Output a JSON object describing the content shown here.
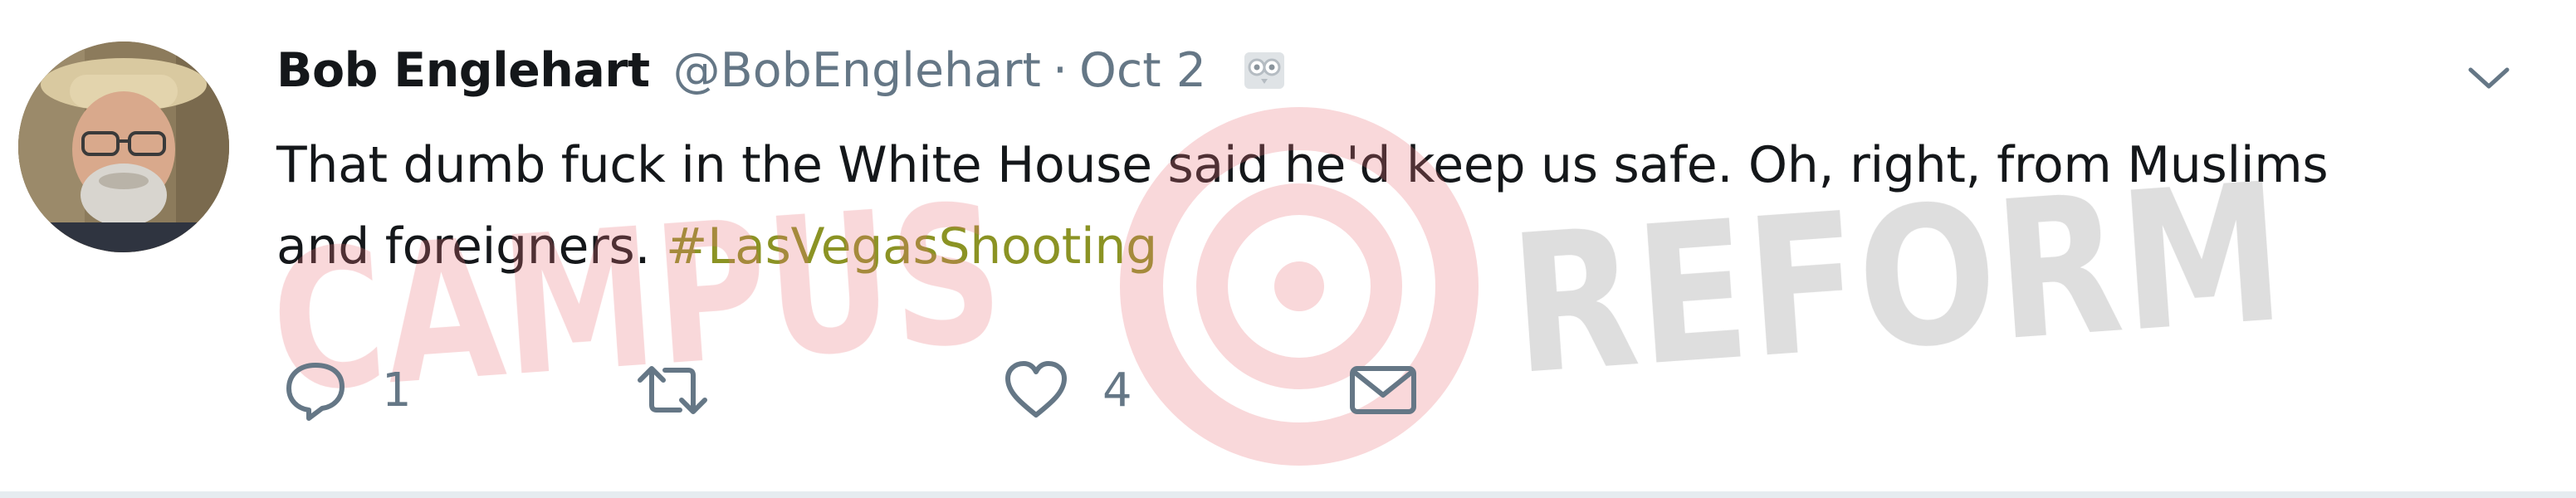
{
  "tweet": {
    "fullname": "Bob Englehart",
    "username": "@BobEnglehart",
    "separator": "·",
    "timestamp": "Oct 2",
    "text": "That dumb fuck in the White House said he'd keep us safe. Oh, right, from Muslims and foreigners.",
    "hashtag": "#LasVegasShooting"
  },
  "actions": {
    "reply_count": "1",
    "retweet_count": "",
    "like_count": "4"
  },
  "icons": {
    "avatar": "profile-photo",
    "owl": "owl-icon",
    "caret": "chevron-down-icon",
    "reply": "reply-icon",
    "retweet": "retweet-icon",
    "like": "heart-icon",
    "dm": "envelope-icon"
  },
  "watermark": {
    "left_text": "CAMPUS",
    "right_text": "REFORM",
    "left_color": "#e8747a",
    "right_color": "#8a8a8a"
  },
  "colors": {
    "hashtag": "#8b9324",
    "secondary": "#657786",
    "primary_text": "#14171a"
  }
}
